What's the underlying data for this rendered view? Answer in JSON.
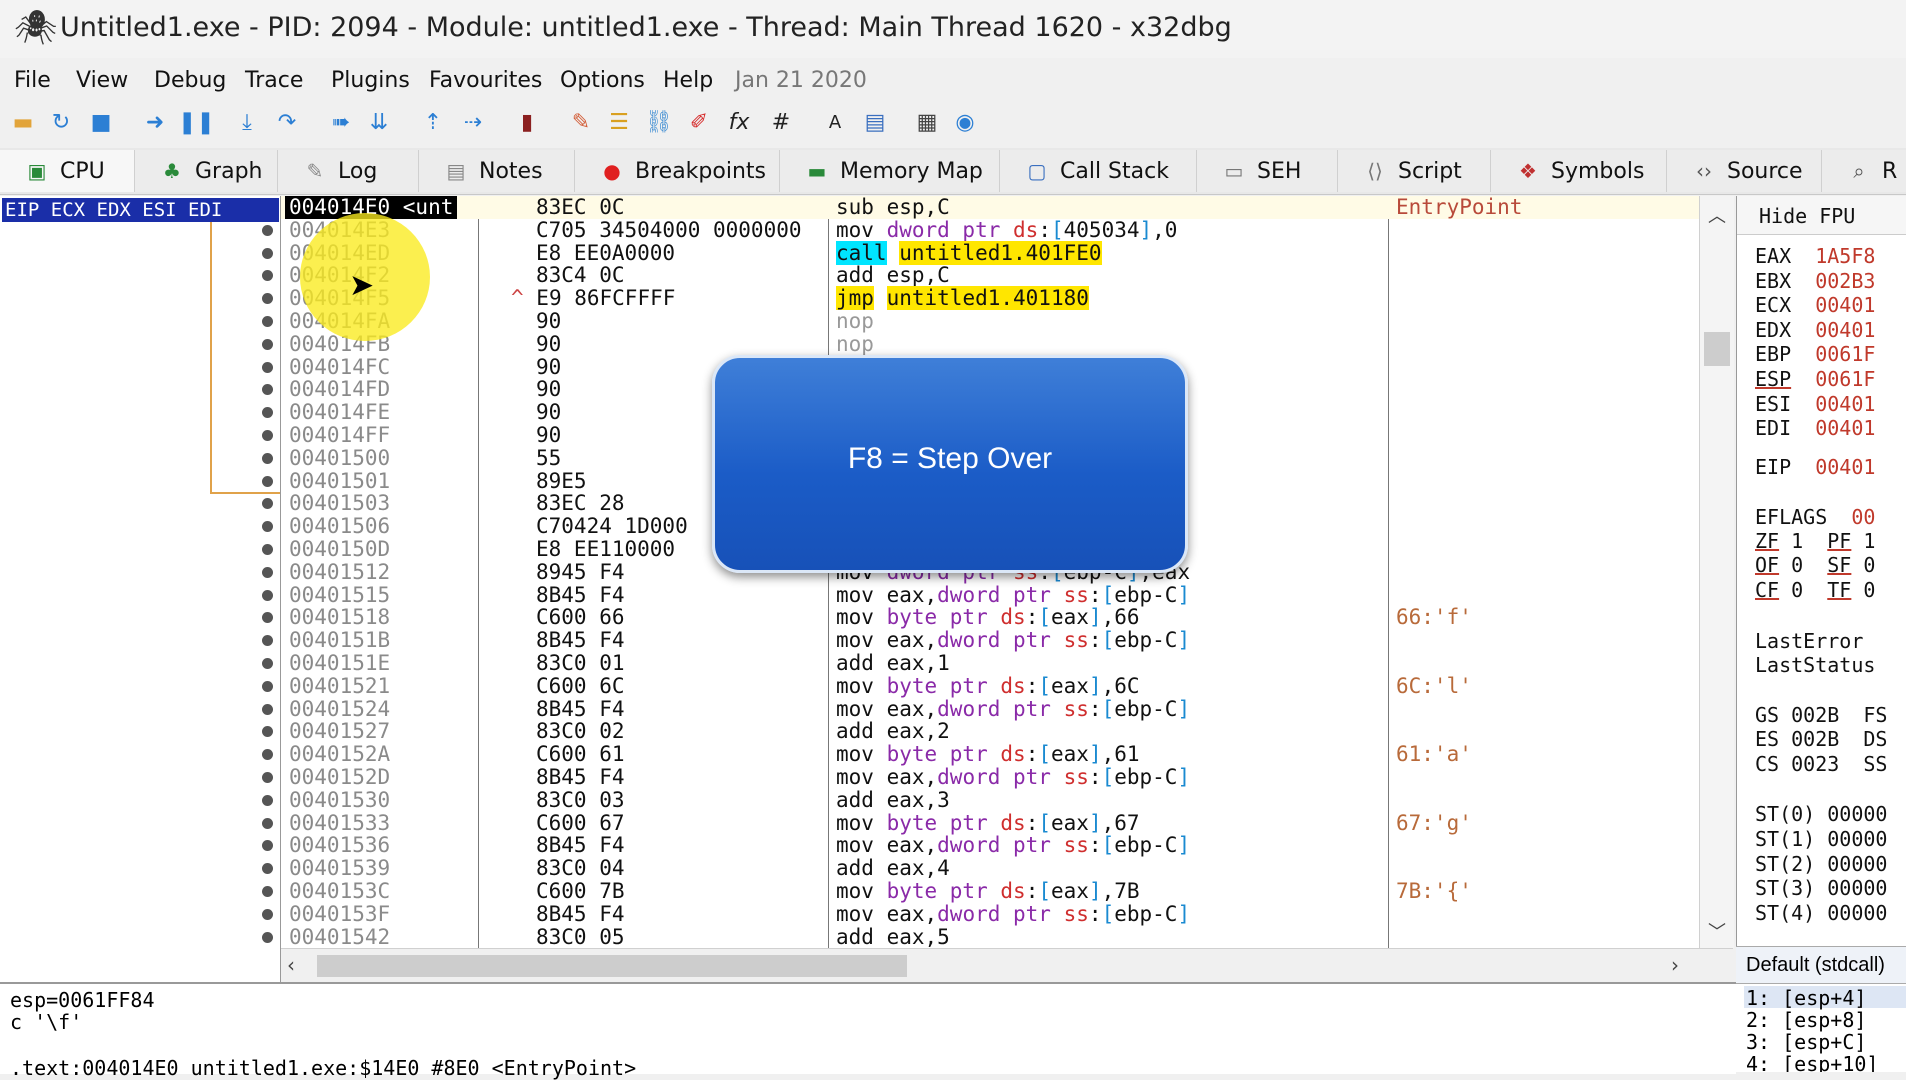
{
  "window": {
    "title": "Untitled1.exe - PID: 2094 - Module: untitled1.exe - Thread: Main Thread 1620 - x32dbg"
  },
  "menu": [
    "File",
    "View",
    "Debug",
    "Trace",
    "Plugins",
    "Favourites",
    "Options",
    "Help"
  ],
  "menu_date": "Jan 21 2020",
  "tabs": [
    "CPU",
    "Graph",
    "Log",
    "Notes",
    "Breakpoints",
    "Memory Map",
    "Call Stack",
    "SEH",
    "Script",
    "Symbols",
    "Source",
    "R"
  ],
  "left_header": "EIP ECX EDX ESI EDI",
  "disasm_rows": [
    {
      "addr": "004014E0 <unt",
      "bytes": "83EC 0C",
      "instr": "sub esp,C",
      "comment": "EntryPoint"
    },
    {
      "addr": "004014E3",
      "bytes": "C705 34504000 0000000",
      "instr": "mov dword ptr ds:[405034],0",
      "comment": ""
    },
    {
      "addr": "004014ED",
      "bytes": "E8 EE0A0000",
      "instr": "call untitled1.401FE0",
      "comment": ""
    },
    {
      "addr": "004014F2",
      "bytes": "83C4 0C",
      "instr": "add esp,C",
      "comment": ""
    },
    {
      "addr": "004014F5",
      "bytes": "E9 86FCFFFF",
      "instr": "jmp untitled1.401180",
      "comment": ""
    },
    {
      "addr": "004014FA",
      "bytes": "90",
      "instr": "nop",
      "comment": ""
    },
    {
      "addr": "004014FB",
      "bytes": "90",
      "instr": "nop",
      "comment": ""
    },
    {
      "addr": "004014FC",
      "bytes": "90",
      "instr": "",
      "comment": ""
    },
    {
      "addr": "004014FD",
      "bytes": "90",
      "instr": "",
      "comment": ""
    },
    {
      "addr": "004014FE",
      "bytes": "90",
      "instr": "",
      "comment": ""
    },
    {
      "addr": "004014FF",
      "bytes": "90",
      "instr": "",
      "comment": ""
    },
    {
      "addr": "00401500",
      "bytes": "55",
      "instr": "",
      "comment": ""
    },
    {
      "addr": "00401501",
      "bytes": "89E5",
      "instr": "",
      "comment": ""
    },
    {
      "addr": "00401503",
      "bytes": "83EC 28",
      "instr": "",
      "comment": ""
    },
    {
      "addr": "00401506",
      "bytes": "C70424 1D000",
      "instr": "",
      "comment": ""
    },
    {
      "addr": "0040150D",
      "bytes": "E8 EE110000",
      "instr": "",
      "comment": ""
    },
    {
      "addr": "00401512",
      "bytes": "8945 F4",
      "instr": "mov dword ptr ss:[ebp-C],eax",
      "comment": ""
    },
    {
      "addr": "00401515",
      "bytes": "8B45 F4",
      "instr": "mov eax,dword ptr ss:[ebp-C]",
      "comment": ""
    },
    {
      "addr": "00401518",
      "bytes": "C600 66",
      "instr": "mov byte ptr ds:[eax],66",
      "comment": "66:'f'"
    },
    {
      "addr": "0040151B",
      "bytes": "8B45 F4",
      "instr": "mov eax,dword ptr ss:[ebp-C]",
      "comment": ""
    },
    {
      "addr": "0040151E",
      "bytes": "83C0 01",
      "instr": "add eax,1",
      "comment": ""
    },
    {
      "addr": "00401521",
      "bytes": "C600 6C",
      "instr": "mov byte ptr ds:[eax],6C",
      "comment": "6C:'l'"
    },
    {
      "addr": "00401524",
      "bytes": "8B45 F4",
      "instr": "mov eax,dword ptr ss:[ebp-C]",
      "comment": ""
    },
    {
      "addr": "00401527",
      "bytes": "83C0 02",
      "instr": "add eax,2",
      "comment": ""
    },
    {
      "addr": "0040152A",
      "bytes": "C600 61",
      "instr": "mov byte ptr ds:[eax],61",
      "comment": "61:'a'"
    },
    {
      "addr": "0040152D",
      "bytes": "8B45 F4",
      "instr": "mov eax,dword ptr ss:[ebp-C]",
      "comment": ""
    },
    {
      "addr": "00401530",
      "bytes": "83C0 03",
      "instr": "add eax,3",
      "comment": ""
    },
    {
      "addr": "00401533",
      "bytes": "C600 67",
      "instr": "mov byte ptr ds:[eax],67",
      "comment": "67:'g'"
    },
    {
      "addr": "00401536",
      "bytes": "8B45 F4",
      "instr": "mov eax,dword ptr ss:[ebp-C]",
      "comment": ""
    },
    {
      "addr": "00401539",
      "bytes": "83C0 04",
      "instr": "add eax,4",
      "comment": ""
    },
    {
      "addr": "0040153C",
      "bytes": "C600 7B",
      "instr": "mov byte ptr ds:[eax],7B",
      "comment": "7B:'{'"
    },
    {
      "addr": "0040153F",
      "bytes": "8B45 F4",
      "instr": "mov eax,dword ptr ss:[ebp-C]",
      "comment": ""
    },
    {
      "addr": "00401542",
      "bytes": "83C0 05",
      "instr": "add eax,5",
      "comment": ""
    }
  ],
  "registers": {
    "hide_fpu": "Hide FPU",
    "regs": [
      {
        "name": "EAX",
        "value": "1A5F8"
      },
      {
        "name": "EBX",
        "value": "002B3"
      },
      {
        "name": "ECX",
        "value": "00401"
      },
      {
        "name": "EDX",
        "value": "00401"
      },
      {
        "name": "EBP",
        "value": "0061F"
      },
      {
        "name": "ESP",
        "value": "0061F"
      },
      {
        "name": "ESI",
        "value": "00401"
      },
      {
        "name": "EDI",
        "value": "00401"
      }
    ],
    "eip": {
      "name": "EIP",
      "value": "00401"
    },
    "eflags": {
      "name": "EFLAGS",
      "value": "00"
    },
    "flags": [
      "ZF 1  PF 1",
      "OF 0  SF 0",
      "CF 0  TF 0"
    ],
    "last_error": "LastError",
    "last_status": "LastStatus",
    "segments": [
      "GS 002B  FS",
      "ES 002B  DS",
      "CS 0023  SS"
    ],
    "fpu": [
      "ST(0) 00000",
      "ST(1) 00000",
      "ST(2) 00000",
      "ST(3) 00000",
      "ST(4) 00000"
    ]
  },
  "info_lines": [
    "esp=0061FF84",
    "c '\\f'",
    ".text:004014E0 untitled1.exe:$14E0 #8E0 <EntryPoint>"
  ],
  "callconv": {
    "label": "Default (stdcall)",
    "args": [
      "1: [esp+4]",
      "2: [esp+8]",
      "3: [esp+C]",
      "4: [esp+10]"
    ]
  },
  "overlay_text": "F8 = Step Over",
  "colors": {
    "highlight_yellow": "#ffe600",
    "highlight_cyan": "#00e5ff",
    "register_value": "#c0392b",
    "eip_bar": "#1a2ea8",
    "callout_blue": "#1b5cc7"
  }
}
